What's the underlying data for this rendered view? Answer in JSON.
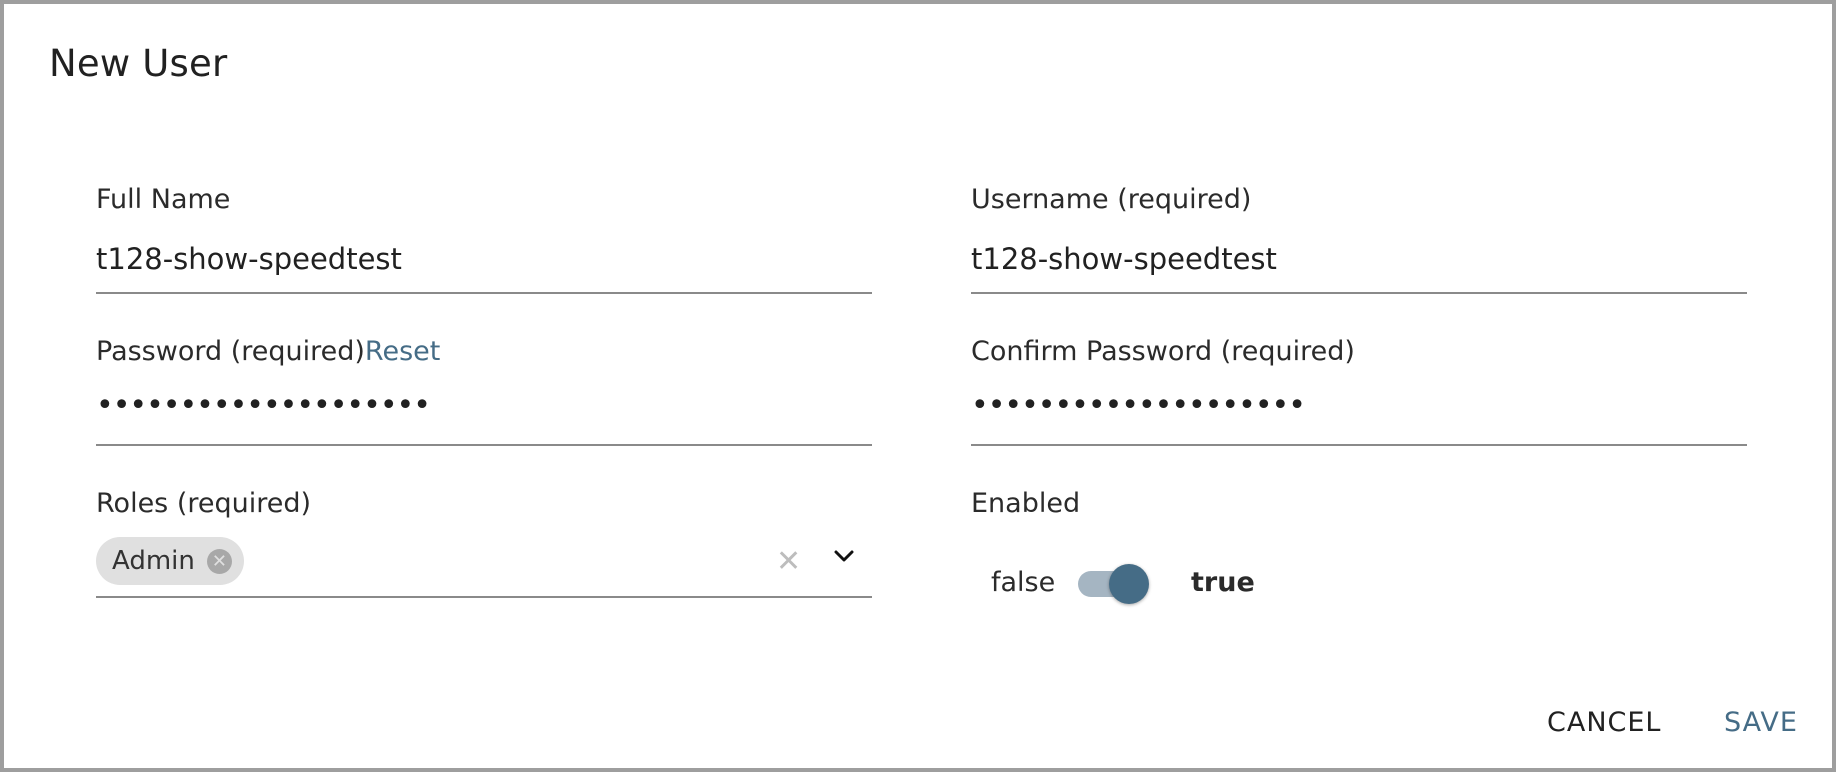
{
  "dialog": {
    "title": "New User"
  },
  "form": {
    "full_name": {
      "label": "Full Name",
      "value": "t128-show-speedtest"
    },
    "username": {
      "label": "Username (required)",
      "value": "t128-show-speedtest"
    },
    "password": {
      "label": "Password (required)",
      "reset_link": "Reset",
      "value": "••••••••••••••••••••"
    },
    "confirm_password": {
      "label": "Confirm Password (required)",
      "value": "••••••••••••••••••••"
    },
    "roles": {
      "label": "Roles (required)",
      "selected": [
        "Admin"
      ]
    },
    "enabled": {
      "label": "Enabled",
      "off_label": "false",
      "on_label": "true",
      "value": true
    }
  },
  "actions": {
    "cancel_label": "CANCEL",
    "save_label": "SAVE"
  },
  "colors": {
    "accent": "#456c86",
    "toggle_track": "#a5b5c2",
    "chip_bg": "#e0e0e0",
    "border": "#9e9e9e"
  },
  "icons": {
    "chip_remove": "close-circle-icon",
    "clear": "close-icon",
    "dropdown": "chevron-down-icon"
  }
}
